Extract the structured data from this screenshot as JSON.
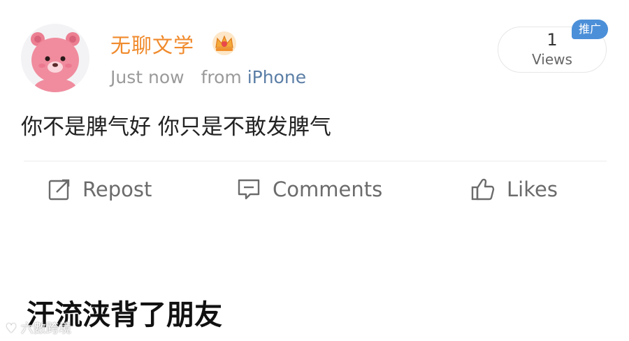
{
  "user": {
    "name": "无聊文学",
    "time": "Just now",
    "source_prefix": "from",
    "source": "iPhone"
  },
  "views": {
    "count": "1",
    "label": "Views"
  },
  "promo_badge": "推广",
  "post": {
    "text": "你不是脾气好 你只是不敢发脾气"
  },
  "actions": {
    "repost": "Repost",
    "comments": "Comments",
    "likes": "Likes"
  },
  "caption": "汗流浃背了朋友",
  "watermark": "六數跨境",
  "icons": {
    "avatar": "pink-bear-avatar",
    "badge": "crown-icon",
    "repost": "repost-icon",
    "comments": "comment-icon",
    "likes": "thumbs-up-icon"
  },
  "colors": {
    "username": "#f08a2c",
    "source_link": "#5b7ea6",
    "promo_badge": "#4b8fd8",
    "action_text": "#6b6b6b"
  }
}
